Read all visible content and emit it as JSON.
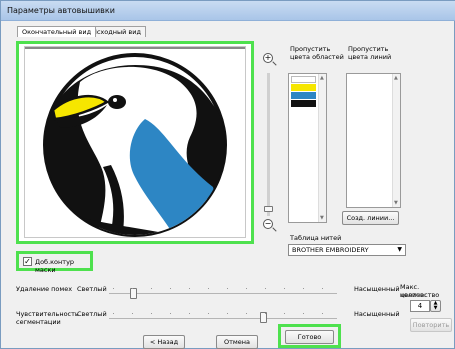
{
  "window": {
    "title": "Параметры автовышивки"
  },
  "tabs": [
    {
      "label": "Окончательный вид"
    },
    {
      "label": "Исходный вид"
    }
  ],
  "colors": {
    "accent": "#4ee14e",
    "penguin_black": "#111111",
    "penguin_blue": "#2d86c4",
    "penguin_yellow": "#f6e600"
  },
  "preview": {
    "checkbox_label": "Доб.контур маски",
    "checked": true
  },
  "skip_areas": {
    "label_line1": "Пропустить",
    "label_line2": "цвета областей",
    "swatches": [
      "#ffffff",
      "#f6e600",
      "#2d86c4",
      "#111111"
    ]
  },
  "skip_lines": {
    "label_line1": "Пропустить",
    "label_line2": "цвета линий",
    "button": "Созд. линии..."
  },
  "thread_table": {
    "label": "Таблица нитей",
    "selected": "BROTHER EMBROIDERY"
  },
  "noise": {
    "label": "Удаление помех",
    "left": "Светлый",
    "right": "Насыщенный",
    "level": 0.14
  },
  "sensitivity": {
    "label_line1": "Чувствительность",
    "label_line2": "сегментации",
    "left": "Светлый",
    "right": "Насыщенный",
    "level": 0.5
  },
  "max_colors": {
    "label_line1": "Макс. количество",
    "label_line2": "цветов:",
    "value": "4",
    "retry_button": "Повторить"
  },
  "buttons": {
    "back": "< Назад",
    "cancel": "Отмена",
    "done": "Готово"
  }
}
